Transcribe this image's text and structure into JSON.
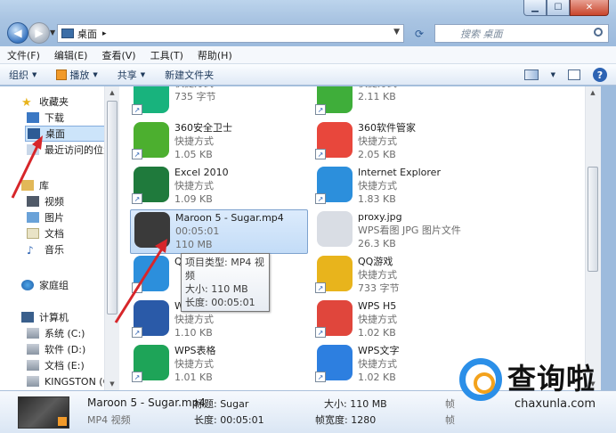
{
  "breadcrumb": {
    "location": "桌面",
    "separator": "▸"
  },
  "search": {
    "placeholder": "搜索 桌面"
  },
  "menu": [
    "文件(F)",
    "编辑(E)",
    "查看(V)",
    "工具(T)",
    "帮助(H)"
  ],
  "toolbar": {
    "organize": "组织",
    "play": "播放",
    "share": "共享",
    "new_folder": "新建文件夹"
  },
  "nav": {
    "favorites": "收藏夹",
    "downloads": "下载",
    "desktop": "桌面",
    "recent": "最近访问的位置",
    "libraries": "库",
    "videos": "视频",
    "pictures": "图片",
    "documents": "文档",
    "music": "音乐",
    "homegroup": "家庭组",
    "computer": "计算机",
    "drive_c": "系统 (C:)",
    "drive_d": "软件 (D:)",
    "drive_e": "文档 (E:)",
    "drive_g": "KINGSTON (G:)"
  },
  "files": [
    {
      "name": "",
      "type": "快捷方式",
      "size": "735 字节",
      "color": "#18b37d"
    },
    {
      "name": "",
      "type": "快捷方式",
      "size": "2.11 KB",
      "color": "#3fae3a"
    },
    {
      "name": "360安全卫士",
      "type": "快捷方式",
      "size": "1.05 KB",
      "color": "#4caf2f"
    },
    {
      "name": "360软件管家",
      "type": "快捷方式",
      "size": "2.05 KB",
      "color": "#e8473c"
    },
    {
      "name": "Excel 2010",
      "type": "快捷方式",
      "size": "1.09 KB",
      "color": "#1f7a3c"
    },
    {
      "name": "Internet Explorer",
      "type": "快捷方式",
      "size": "1.83 KB",
      "color": "#2c8fdc"
    },
    {
      "name": "Maroon 5 - Sugar.mp4",
      "type": "00:05:01",
      "size": "110 MB",
      "color": "#3a3a3a"
    },
    {
      "name": "proxy.jpg",
      "type": "WPS看图 JPG 图片文件",
      "size": "26.3 KB",
      "color": "#d9dde4"
    },
    {
      "name": "Q",
      "type": "",
      "size": "",
      "color": "#2c8fdc"
    },
    {
      "name": "QQ游戏",
      "type": "快捷方式",
      "size": "733 字节",
      "color": "#e8b41c"
    },
    {
      "name": "Word 2010",
      "type": "快捷方式",
      "size": "1.10 KB",
      "color": "#2a5aa8"
    },
    {
      "name": "WPS H5",
      "type": "快捷方式",
      "size": "1.02 KB",
      "color": "#e0463c"
    },
    {
      "name": "WPS表格",
      "type": "快捷方式",
      "size": "1.01 KB",
      "color": "#1ea458"
    },
    {
      "name": "WPS文字",
      "type": "快捷方式",
      "size": "1.02 KB",
      "color": "#2d7fe0"
    }
  ],
  "tooltip": {
    "type": "项目类型: MP4 视频",
    "size": "大小: 110 MB",
    "length": "长度: 00:05:01"
  },
  "details": {
    "name": "Maroon 5 - Sugar.mp4",
    "kind": "MP4 视频",
    "tag_label": "标题: Sugar",
    "length_label": "长度: 00:05:01",
    "size_label": "大小: 110 MB",
    "width_label": "帧宽度: 1280",
    "cut1": "帧",
    "cut2": "帧"
  },
  "watermark": {
    "text": "查询啦",
    "url": "chaxunla.com"
  }
}
